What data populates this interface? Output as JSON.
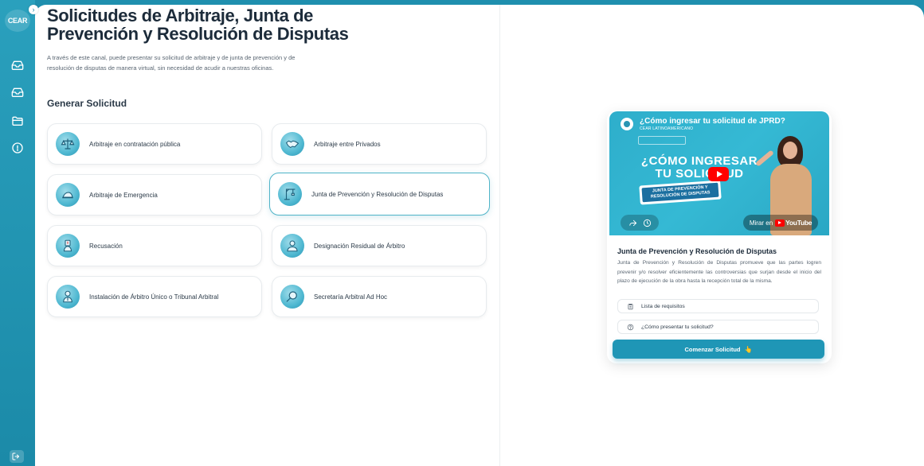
{
  "sidebar": {
    "logo_text": "CEAR",
    "expand_icon": "chevron-right-icon",
    "items": [
      {
        "icon": "inbox-icon"
      },
      {
        "icon": "inbox-icon"
      },
      {
        "icon": "folder-icon"
      },
      {
        "icon": "info-icon"
      }
    ],
    "logout_icon": "logout-icon"
  },
  "header": {
    "title": "Solicitudes de Arbitraje, Junta de Prevención y Resolución de Disputas",
    "description": "A través de este canal, puede presentar su solicitud de arbitraje y de junta de prevención y de resolución de disputas de manera virtual, sin necesidad de acudir a nuestras oficinas."
  },
  "section_title": "Generar Solicitud",
  "cards": [
    {
      "label": "Arbitraje en contratación pública",
      "icon": "scales-icon"
    },
    {
      "label": "Arbitraje entre Privados",
      "icon": "handshake-icon"
    },
    {
      "label": "Arbitraje de Emergencia",
      "icon": "emergency-icon"
    },
    {
      "label": "Junta de Prevención y Resolución de Disputas",
      "icon": "crane-icon",
      "active": true
    },
    {
      "label": "Recusación",
      "icon": "recusal-icon"
    },
    {
      "label": "Designación Residual de Árbitro",
      "icon": "arbitrator-icon"
    },
    {
      "label": "Instalación de Árbitro Único o Tribunal Arbitral",
      "icon": "tribunal-icon"
    },
    {
      "label": "Secretaría Arbitral Ad Hoc",
      "icon": "magnifier-icon"
    }
  ],
  "panel": {
    "video": {
      "title": "¿Cómo ingresar tu solicitud de JPRD?",
      "channel": "CEAR LATINOAMERICANO",
      "headline": "¿CÓMO INGRESAR TU SOLICITUD",
      "tag": "JUNTA DE PREVENCIÓN Y RESOLUCIÓN DE DISPUTAS",
      "watch_label": "Mirar en",
      "watch_brand": "YouTube"
    },
    "title": "Junta de Prevención y Resolución de Disputas",
    "description": "Junta de Prevención y Resolución de Disputas promueve que las partes logren prevenir y/o resolver eficientemente las controversias que surjan desde el inicio del plazo de ejecución de la obra hasta la recepción total de la misma.",
    "options": [
      {
        "label": "Lista de requisitos",
        "icon": "clipboard-icon"
      },
      {
        "label": "¿Cómo presentar tu solicitud?",
        "icon": "question-icon"
      }
    ],
    "button_label": "Comenzar Solicitud"
  }
}
